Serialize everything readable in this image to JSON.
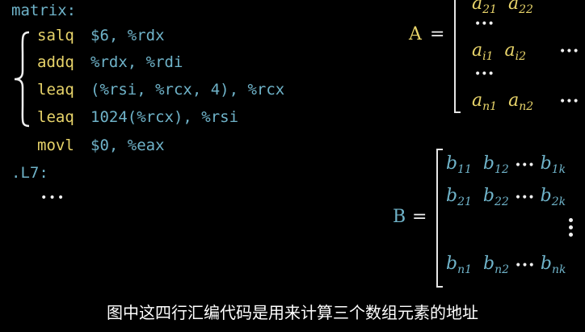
{
  "code": {
    "label_matrix": "matrix:",
    "lines": [
      {
        "mnemonic": "salq",
        "operands": "$6, %rdx"
      },
      {
        "mnemonic": "addq",
        "operands": "%rdx, %rdi"
      },
      {
        "mnemonic": "leaq",
        "operands": "(%rsi, %rcx, 4), %rcx"
      },
      {
        "mnemonic": "leaq",
        "operands": "1024(%rcx), %rsi"
      },
      {
        "mnemonic": "movl",
        "operands": "$0, %eax"
      }
    ],
    "label_l7": ".L7:",
    "ellipsis": "•••"
  },
  "matrix_a": {
    "name": "A",
    "equals": "=",
    "rows": [
      [
        "a",
        "21",
        "a",
        "22"
      ],
      [
        "a",
        "i1",
        "a",
        "i2"
      ],
      [
        "a",
        "n1",
        "a",
        "n2"
      ]
    ],
    "dots": "•••"
  },
  "matrix_b": {
    "name": "B",
    "equals": "=",
    "rows": [
      [
        "b",
        "11",
        "b",
        "12",
        "b",
        "1k"
      ],
      [
        "b",
        "21",
        "b",
        "22",
        "b",
        "2k"
      ],
      [
        "b",
        "n1",
        "b",
        "n2",
        "b",
        "nk"
      ]
    ],
    "dots": "•••"
  },
  "subtitle": "图中这四行汇编代码是用来计算三个数组元素的地址",
  "colors": {
    "background": "#000000",
    "mnemonic": "#e8d46a",
    "operand": "#6fb3c9",
    "subtitle": "#ffffff"
  }
}
